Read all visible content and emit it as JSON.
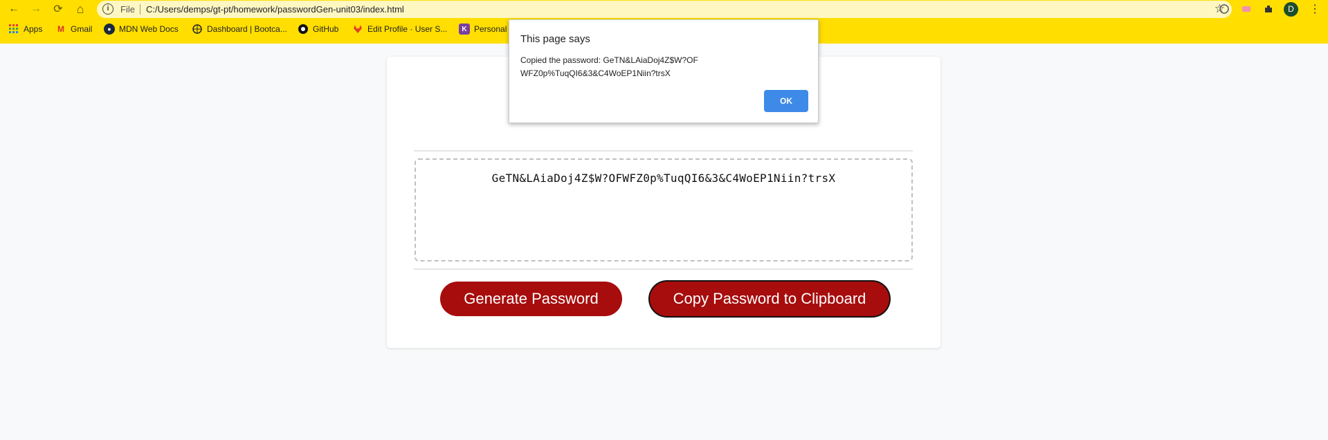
{
  "browser": {
    "nav": {
      "back": "←",
      "forward": "→",
      "reload": "⟳",
      "home": "⌂"
    },
    "omnibox": {
      "info_icon": "i",
      "scheme": "File",
      "url": "C:/Users/demps/gt-pt/homework/passwordGen-unit03/index.html"
    },
    "avatar_letter": "D"
  },
  "bookmarks": [
    {
      "label": "Apps",
      "icon": "apps-grid-icon"
    },
    {
      "label": "Gmail",
      "icon": "gmail-icon"
    },
    {
      "label": "MDN Web Docs",
      "icon": "mdn-icon"
    },
    {
      "label": "Dashboard | Bootca...",
      "icon": "globe-icon"
    },
    {
      "label": "GitHub",
      "icon": "github-icon"
    },
    {
      "label": "Edit Profile · User S...",
      "icon": "gitlab-icon"
    },
    {
      "label": "Personal",
      "icon": "personal-icon"
    }
  ],
  "page": {
    "password": "GeTN&LAiaDoj4Z$W?OFWFZ0p%TuqQI6&3&C4WoEP1Niin?trsX",
    "generate_label": "Generate Password",
    "copy_label": "Copy Password to Clipboard"
  },
  "dialog": {
    "title": "This page says",
    "message": "Copied the password: GeTN&LAiaDoj4Z$W?OFWFZ0p%TuqQI6&3&C4WoEP1Niin?trsX",
    "ok_label": "OK"
  },
  "colors": {
    "chrome": "#ffde00",
    "button": "#a70d0d",
    "dialog_ok": "#3e8ae8"
  }
}
